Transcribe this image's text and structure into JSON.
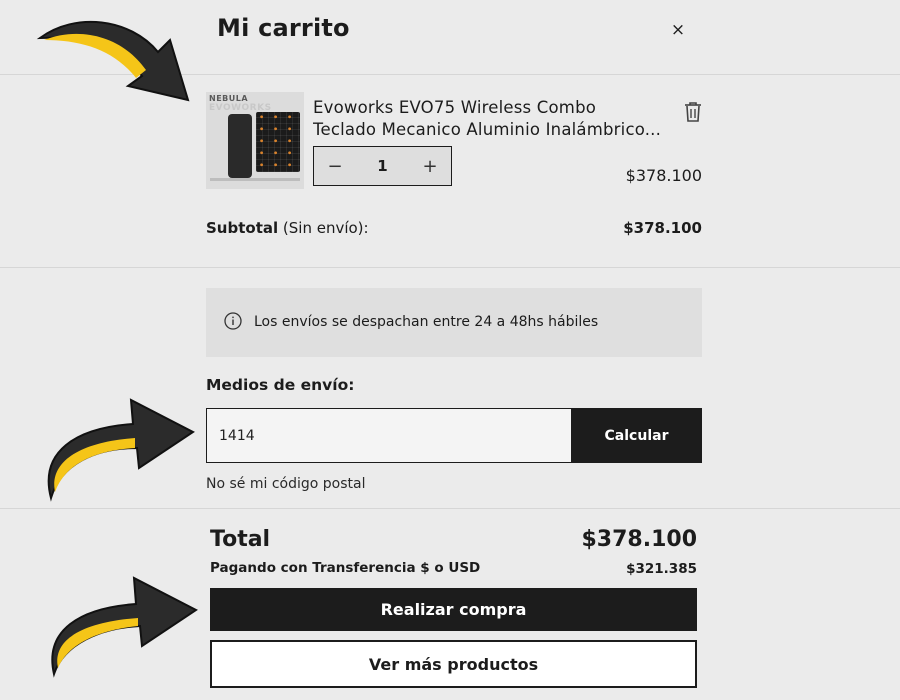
{
  "cart": {
    "title": "Mi carrito",
    "close_symbol": "×"
  },
  "product": {
    "image_brand": "NEBULA",
    "image_brand2": "EVOWORKS",
    "name_line1": "Evoworks EVO75 Wireless Combo",
    "name_line2": "Teclado Mecanico Aluminio Inalámbrico...",
    "quantity": "1",
    "decrement_symbol": "−",
    "increment_symbol": "+",
    "price": "$378.100",
    "icons": [
      "trash-icon",
      "minus-icon",
      "plus-icon"
    ]
  },
  "subtotal": {
    "label_bold": "Subtotal",
    "label_rest": " (Sin envío):",
    "value": "$378.100"
  },
  "shipping": {
    "info_text": "Los envíos se despachan entre 24 a 48hs hábiles",
    "label": "Medios de envío:",
    "zip_value": "1414",
    "calculate_label": "Calcular",
    "no_zip_link": "No sé mi código postal"
  },
  "totals": {
    "total_label": "Total",
    "total_value": "$378.100",
    "payment_label": "Pagando con Transferencia $ o USD",
    "payment_value": "$321.385"
  },
  "actions": {
    "checkout_label": "Realizar compra",
    "more_products_label": "Ver más productos"
  },
  "colors": {
    "background": "#ebebeb",
    "primary_button": "#1c1c1c",
    "info_box": "#dfdfdf",
    "arrow_fill": "#f5c518",
    "arrow_dark": "#2b2b2b"
  }
}
